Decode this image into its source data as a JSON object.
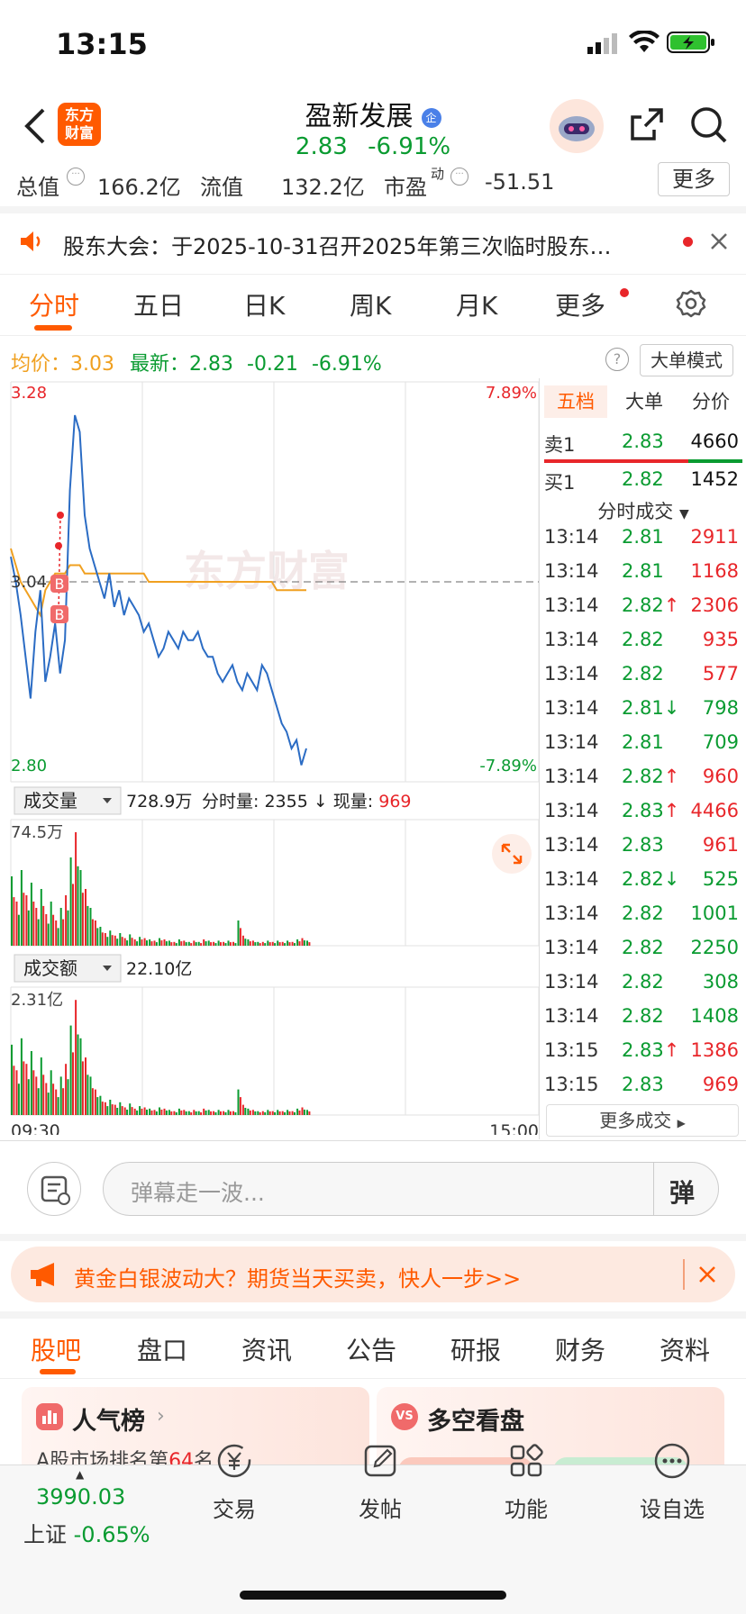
{
  "status": {
    "time": "13:15"
  },
  "header": {
    "title": "盈新发展",
    "badge": "企",
    "price": "2.83",
    "change_pct": "-6.91%",
    "logo_line1": "东方",
    "logo_line2": "财富"
  },
  "stats": {
    "total_label": "总值",
    "total_value": "166.2亿",
    "float_label": "流值",
    "float_value": "132.2亿",
    "pe_label": "市盈",
    "pe_sup": "动",
    "pe_value": "-51.51",
    "more_label": "更多"
  },
  "notice": {
    "text": "股东大会：于2025-10-31召开2025年第三次临时股东…"
  },
  "chart_tabs": [
    "分时",
    "五日",
    "日K",
    "周K",
    "月K",
    "更多"
  ],
  "info": {
    "avg_label": "均价：",
    "avg_value": "3.03",
    "latest_label": "最新：",
    "latest_value": "2.83",
    "change": "-0.21",
    "change_pct": "-6.91%",
    "big_order_mode": "大单模式"
  },
  "price_chart": {
    "y_max_label": "3.28",
    "y_min_label": "2.80",
    "mid_label": "3.04",
    "pct_max_label": "7.89%",
    "pct_min_label": "-7.89%",
    "watermark": "东方财富",
    "buy_marker": "B",
    "volume_label": "成交量",
    "volume_total": "728.9万",
    "volume_detail_prefix": "分时量: 2355 ↓ 现量: ",
    "volume_current": "969",
    "volume_max_label": "74.5万",
    "amount_label": "成交额",
    "amount_total": "22.10亿",
    "amount_max_label": "2.31亿",
    "time_start": "09:30",
    "time_end": "15:00"
  },
  "chart_data": {
    "type": "line",
    "title": "",
    "ylim": [
      2.8,
      3.28
    ],
    "prev_close": 3.04,
    "xlim": [
      "09:30",
      "15:00"
    ],
    "series": [
      {
        "values": [
          3.07,
          3.04,
          3.0,
          2.95,
          2.9,
          2.98,
          3.03,
          2.92,
          2.95,
          2.99,
          2.93,
          2.97,
          3.15,
          3.24,
          3.22,
          3.12,
          3.08,
          3.06,
          3.04,
          3.02,
          3.05,
          3.01,
          3.03,
          3.0,
          3.02,
          3.01,
          3.0,
          2.98,
          2.99,
          2.97,
          2.95,
          2.96,
          2.98,
          2.97,
          2.96,
          2.98,
          2.97,
          2.97,
          2.98,
          2.96,
          2.95,
          2.95,
          2.93,
          2.92,
          2.93,
          2.94,
          2.92,
          2.91,
          2.93,
          2.92,
          2.91,
          2.94,
          2.93,
          2.91,
          2.89,
          2.87,
          2.86,
          2.84,
          2.85,
          2.82,
          2.84
        ]
      },
      {
        "values": [
          3.08,
          3.06,
          3.04,
          3.03,
          3.02,
          3.01,
          3.0,
          3.03,
          3.04,
          3.05,
          3.05,
          3.05,
          3.06,
          3.06,
          3.06,
          3.05,
          3.05,
          3.05,
          3.05,
          3.05,
          3.05,
          3.05,
          3.05,
          3.05,
          3.05,
          3.05,
          3.05,
          3.05,
          3.04,
          3.04,
          3.04,
          3.04,
          3.04,
          3.04,
          3.04,
          3.04,
          3.04,
          3.04,
          3.04,
          3.04,
          3.04,
          3.04,
          3.04,
          3.04,
          3.04,
          3.04,
          3.04,
          3.04,
          3.04,
          3.04,
          3.04,
          3.04,
          3.04,
          3.04,
          3.03,
          3.03,
          3.03,
          3.03,
          3.03,
          3.03,
          3.03
        ]
      }
    ]
  },
  "volume_bars": [
    55,
    35,
    60,
    40,
    50,
    30,
    45,
    25,
    35,
    20,
    30,
    40,
    70,
    90,
    60,
    45,
    30,
    20,
    15,
    10,
    12,
    8,
    10,
    6,
    9,
    5,
    7,
    6,
    5,
    4,
    6,
    5,
    4,
    3,
    5,
    4,
    3,
    4,
    3,
    5,
    4,
    3,
    4,
    3,
    4,
    3,
    20,
    8,
    5,
    4,
    3,
    3,
    4,
    3,
    4,
    3,
    4,
    3,
    5,
    6,
    4
  ],
  "side": {
    "tabs": [
      "五档",
      "大单",
      "分价"
    ],
    "sell1_label": "卖1",
    "sell1_price": "2.83",
    "sell1_vol": "4660",
    "buy1_label": "买1",
    "buy1_price": "2.82",
    "buy1_vol": "1452",
    "trades_title": "分时成交",
    "more_trades": "更多成交",
    "trades": [
      {
        "time": "13:14",
        "price": "2.81",
        "arrow": "",
        "vol": "2911",
        "pc": "green",
        "vc": "red"
      },
      {
        "time": "13:14",
        "price": "2.81",
        "arrow": "",
        "vol": "1168",
        "pc": "green",
        "vc": "red"
      },
      {
        "time": "13:14",
        "price": "2.82",
        "arrow": "↑",
        "vol": "2306",
        "pc": "green",
        "vc": "red"
      },
      {
        "time": "13:14",
        "price": "2.82",
        "arrow": "",
        "vol": "935",
        "pc": "green",
        "vc": "red"
      },
      {
        "time": "13:14",
        "price": "2.82",
        "arrow": "",
        "vol": "577",
        "pc": "green",
        "vc": "red"
      },
      {
        "time": "13:14",
        "price": "2.81",
        "arrow": "↓",
        "vol": "798",
        "pc": "green",
        "vc": "green"
      },
      {
        "time": "13:14",
        "price": "2.81",
        "arrow": "",
        "vol": "709",
        "pc": "green",
        "vc": "green"
      },
      {
        "time": "13:14",
        "price": "2.82",
        "arrow": "↑",
        "vol": "960",
        "pc": "green",
        "vc": "red"
      },
      {
        "time": "13:14",
        "price": "2.83",
        "arrow": "↑",
        "vol": "4466",
        "pc": "green",
        "vc": "red"
      },
      {
        "time": "13:14",
        "price": "2.83",
        "arrow": "",
        "vol": "961",
        "pc": "green",
        "vc": "red"
      },
      {
        "time": "13:14",
        "price": "2.82",
        "arrow": "↓",
        "vol": "525",
        "pc": "green",
        "vc": "green"
      },
      {
        "time": "13:14",
        "price": "2.82",
        "arrow": "",
        "vol": "1001",
        "pc": "green",
        "vc": "green"
      },
      {
        "time": "13:14",
        "price": "2.82",
        "arrow": "",
        "vol": "2250",
        "pc": "green",
        "vc": "green"
      },
      {
        "time": "13:14",
        "price": "2.82",
        "arrow": "",
        "vol": "308",
        "pc": "green",
        "vc": "green"
      },
      {
        "time": "13:14",
        "price": "2.82",
        "arrow": "",
        "vol": "1408",
        "pc": "green",
        "vc": "green"
      },
      {
        "time": "13:15",
        "price": "2.83",
        "arrow": "↑",
        "vol": "1386",
        "pc": "green",
        "vc": "red"
      },
      {
        "time": "13:15",
        "price": "2.83",
        "arrow": "",
        "vol": "969",
        "pc": "green",
        "vc": "red"
      }
    ]
  },
  "comment": {
    "placeholder": "弹幕走一波...",
    "danmu_btn": "弹"
  },
  "ad": {
    "text": "黄金白银波动大？期货当天买卖，快人一步>>"
  },
  "news_tabs": [
    "股吧",
    "盘口",
    "资讯",
    "公告",
    "研报",
    "财务",
    "资料"
  ],
  "cards": {
    "rank_title": "人气榜",
    "rank_text_prefix": "A股市场排名第",
    "rank_num": "64",
    "rank_suffix": "名",
    "bull_title": "多空看盘",
    "vs_badge": "VS"
  },
  "bottom_nav": {
    "index_value": "3990.03",
    "index_name": "上证",
    "index_change": "-0.65%",
    "trade": "交易",
    "post": "发帖",
    "func": "功能",
    "watch": "设自选"
  },
  "colors": {
    "up": "#e8262a",
    "down": "#0a9b31",
    "price_line": "#2b6cc4",
    "avg_line": "#f0a020",
    "brand": "#ff5a00"
  }
}
